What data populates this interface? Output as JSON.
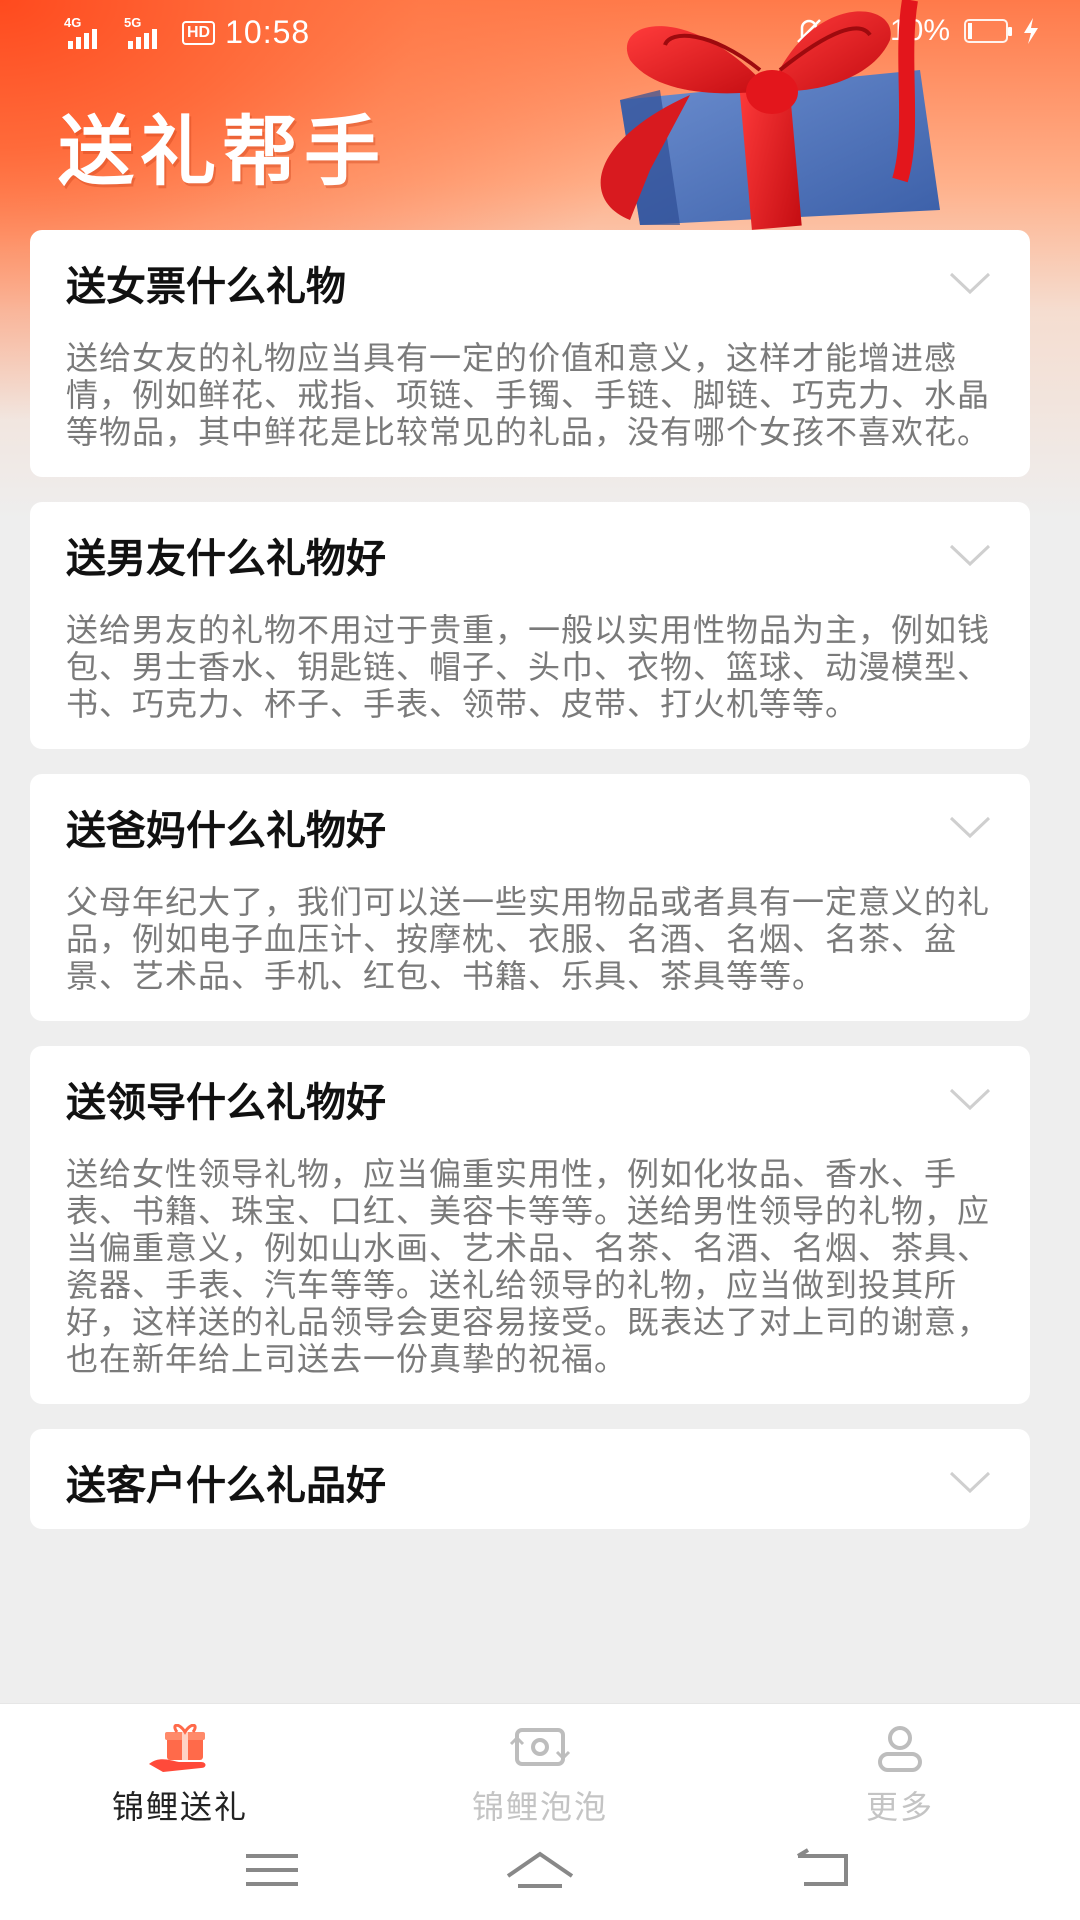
{
  "status_bar": {
    "net1": "4G",
    "net2": "5G",
    "hd_badge": "HD",
    "time": "10:58",
    "battery_percent": "10%"
  },
  "header": {
    "title": "送礼帮手"
  },
  "cards": [
    {
      "question": "送女票什么礼物",
      "answer": "送给女友的礼物应当具有一定的价值和意义，这样才能增进感情，例如鲜花、戒指、项链、手镯、手链、脚链、巧克力、水晶等物品，其中鲜花是比较常见的礼品，没有哪个女孩不喜欢花。"
    },
    {
      "question": "送男友什么礼物好",
      "answer": "送给男友的礼物不用过于贵重，一般以实用性物品为主，例如钱包、男士香水、钥匙链、帽子、头巾、衣物、篮球、动漫模型、书、巧克力、杯子、手表、领带、皮带、打火机等等。"
    },
    {
      "question": "送爸妈什么礼物好",
      "answer": "父母年纪大了，我们可以送一些实用物品或者具有一定意义的礼品，例如电子血压计、按摩枕、衣服、名酒、名烟、名茶、盆景、艺术品、手机、红包、书籍、乐具、茶具等等。"
    },
    {
      "question": "送领导什么礼物好",
      "answer": "送给女性领导礼物，应当偏重实用性，例如化妆品、香水、手表、书籍、珠宝、口红、美容卡等等。送给男性领导的礼物，应当偏重意义，例如山水画、艺术品、名茶、名酒、名烟、茶具、瓷器、手表、汽车等等。送礼给领导的礼物，应当做到投其所好，这样送的礼品领导会更容易接受。既表达了对上司的谢意，也在新年给上司送去一份真挚的祝福。"
    },
    {
      "question": "送客户什么礼品好",
      "answer": ""
    }
  ],
  "tabs": [
    {
      "label": "锦鲤送礼",
      "icon": "gift-hand-icon",
      "active": true
    },
    {
      "label": "锦鲤泡泡",
      "icon": "money-exchange-icon",
      "active": false
    },
    {
      "label": "更多",
      "icon": "person-icon",
      "active": false
    }
  ],
  "colors": {
    "accent": "#ff5a2a",
    "header_gradient_start": "#ff4a1e",
    "card_bg": "#ffffff",
    "page_bg": "#eeeeee",
    "answer_text": "#7a7a7a",
    "tab_inactive": "#c4c4c4"
  }
}
